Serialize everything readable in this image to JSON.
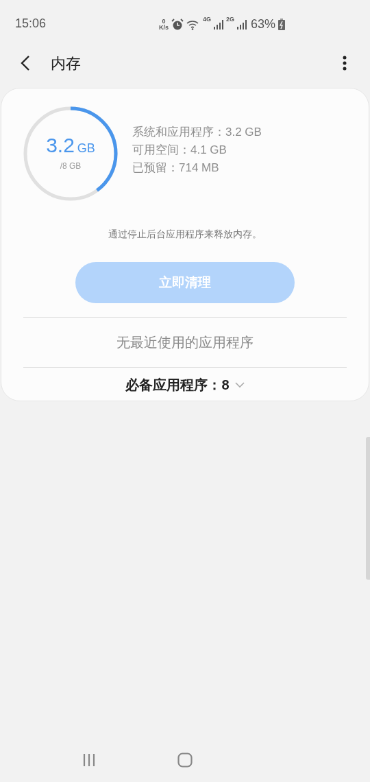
{
  "status_bar": {
    "time": "15:06",
    "net_speed": "0",
    "net_unit": "K/s",
    "network_1": "4G",
    "network_2": "2G",
    "battery": "63%"
  },
  "header": {
    "title": "内存"
  },
  "memory": {
    "used": "3.2",
    "used_unit": "GB",
    "total": "/8 GB",
    "level": 0.4,
    "details": [
      "系统和应用程序：3.2 GB",
      "可用空间：4.1 GB",
      "已预留：714 MB"
    ],
    "hint": "通过停止后台应用程序来释放内存。",
    "clean_button": {
      "label": "立即清理",
      "disabled": true
    },
    "recent_apps": "无最近使用的应用程序",
    "essential_apps": "必备应用程序：8"
  }
}
